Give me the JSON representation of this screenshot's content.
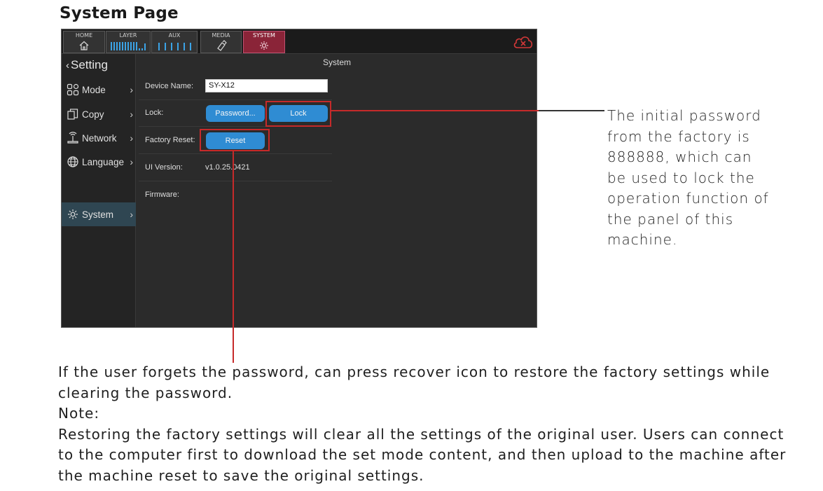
{
  "page_title": "System Page",
  "topbar": {
    "tabs": [
      {
        "label": "HOME",
        "icon": "home-icon"
      },
      {
        "label": "LAYER",
        "icon": "level-meter-icon"
      },
      {
        "label": "AUX",
        "icon": "level-meter-icon"
      },
      {
        "label": "MEDIA",
        "icon": "usb-drive-icon"
      },
      {
        "label": "SYSTEM",
        "icon": "gear-icon"
      }
    ],
    "active_tab": "SYSTEM",
    "status_icon": "cloud-disconnected-icon"
  },
  "sidebar": {
    "header": "Setting",
    "items": [
      {
        "label": "Mode",
        "icon": "grid-icon"
      },
      {
        "label": "Copy",
        "icon": "copy-icon"
      },
      {
        "label": "Network",
        "icon": "network-icon"
      },
      {
        "label": "Language",
        "icon": "globe-icon"
      },
      {
        "label": "System",
        "icon": "gear-icon",
        "active": true
      }
    ]
  },
  "main": {
    "section_title": "System",
    "device_name_label": "Device Name:",
    "device_name_value": "SY-X12",
    "lock_label": "Lock:",
    "password_button": "Password...",
    "lock_button": "Lock",
    "factory_reset_label": "Factory Reset:",
    "reset_button": "Reset",
    "ui_version_label": "UI Version:",
    "ui_version_value": "v1.0.25.0421",
    "firmware_label": "Firmware:"
  },
  "annotations": {
    "lock_callout": "The initial password from the factory is 888888, which can be used to lock the operation function of the panel of this machine.",
    "reset_callout": "If the user forgets the password, can press recover icon to restore the factory settings while clearing the password.",
    "note_label": "Note:",
    "note_text": "Restoring the factory settings will clear all the settings of the original user. Users can connect to the computer first to download the set mode content, and then upload to the machine after the machine reset to save the original settings."
  },
  "colors": {
    "accent_button": "#2f8cd3",
    "highlight": "#c62a2a",
    "active_tab": "#8a2438",
    "meter": "#3ba3e6"
  }
}
